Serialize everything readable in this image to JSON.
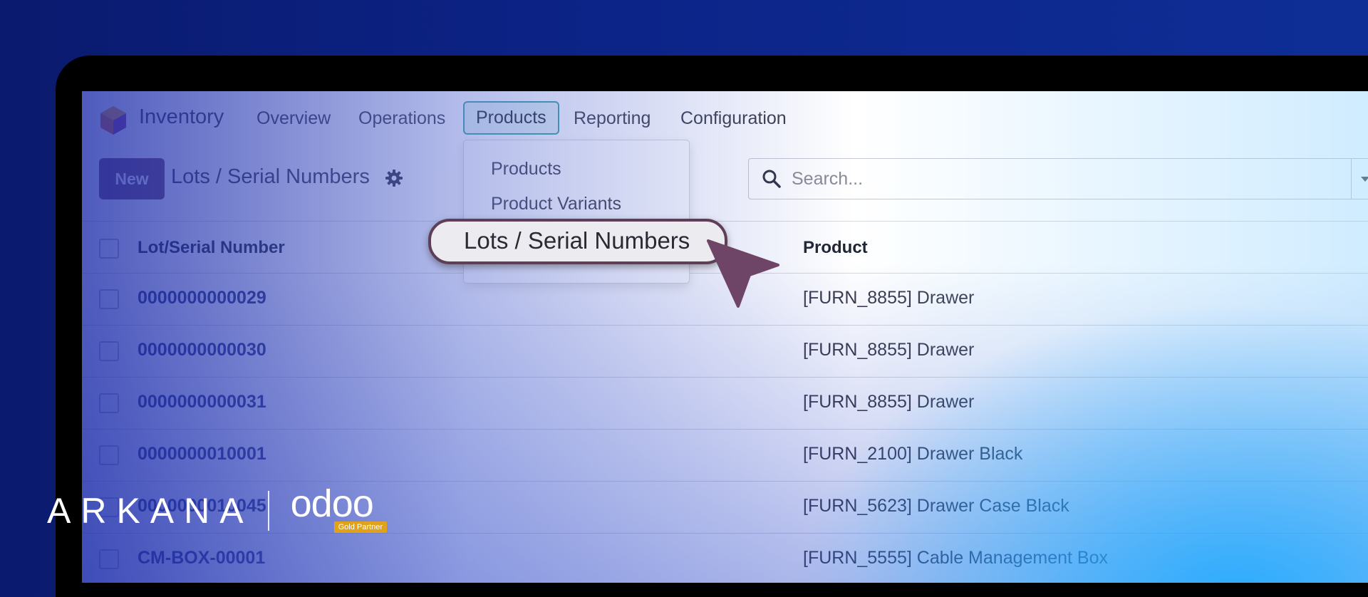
{
  "app": {
    "title": "Inventory"
  },
  "nav": {
    "items": [
      "Overview",
      "Operations",
      "Products",
      "Reporting",
      "Configuration"
    ],
    "active": "Products"
  },
  "dropdown": {
    "items": [
      "Products",
      "Product Variants",
      "Lots / Serial Numbers"
    ]
  },
  "toolbar": {
    "new_label": "New",
    "breadcrumb": "Lots / Serial Numbers",
    "gear_icon": "gear-icon"
  },
  "search": {
    "placeholder": "Search..."
  },
  "table": {
    "columns": [
      "Lot/Serial Number",
      "Product"
    ],
    "rows": [
      {
        "lot": "0000000000029",
        "product": "[FURN_8855] Drawer"
      },
      {
        "lot": "0000000000030",
        "product": "[FURN_8855] Drawer"
      },
      {
        "lot": "0000000000031",
        "product": "[FURN_8855] Drawer"
      },
      {
        "lot": "0000000010001",
        "product": "[FURN_2100] Drawer Black"
      },
      {
        "lot": "0000000010045",
        "product": "[FURN_5623] Drawer Case Black"
      },
      {
        "lot": "CM-BOX-00001",
        "product": "[FURN_5555] Cable Management Box"
      }
    ]
  },
  "callout": {
    "label": "Lots / Serial Numbers"
  },
  "branding": {
    "company": "ARKANA",
    "partner_logo": "odoo",
    "badge": "Gold Partner"
  },
  "colors": {
    "primary": "#714b67",
    "active_tab_border": "#3aa0a5",
    "background": "#0c2488"
  }
}
